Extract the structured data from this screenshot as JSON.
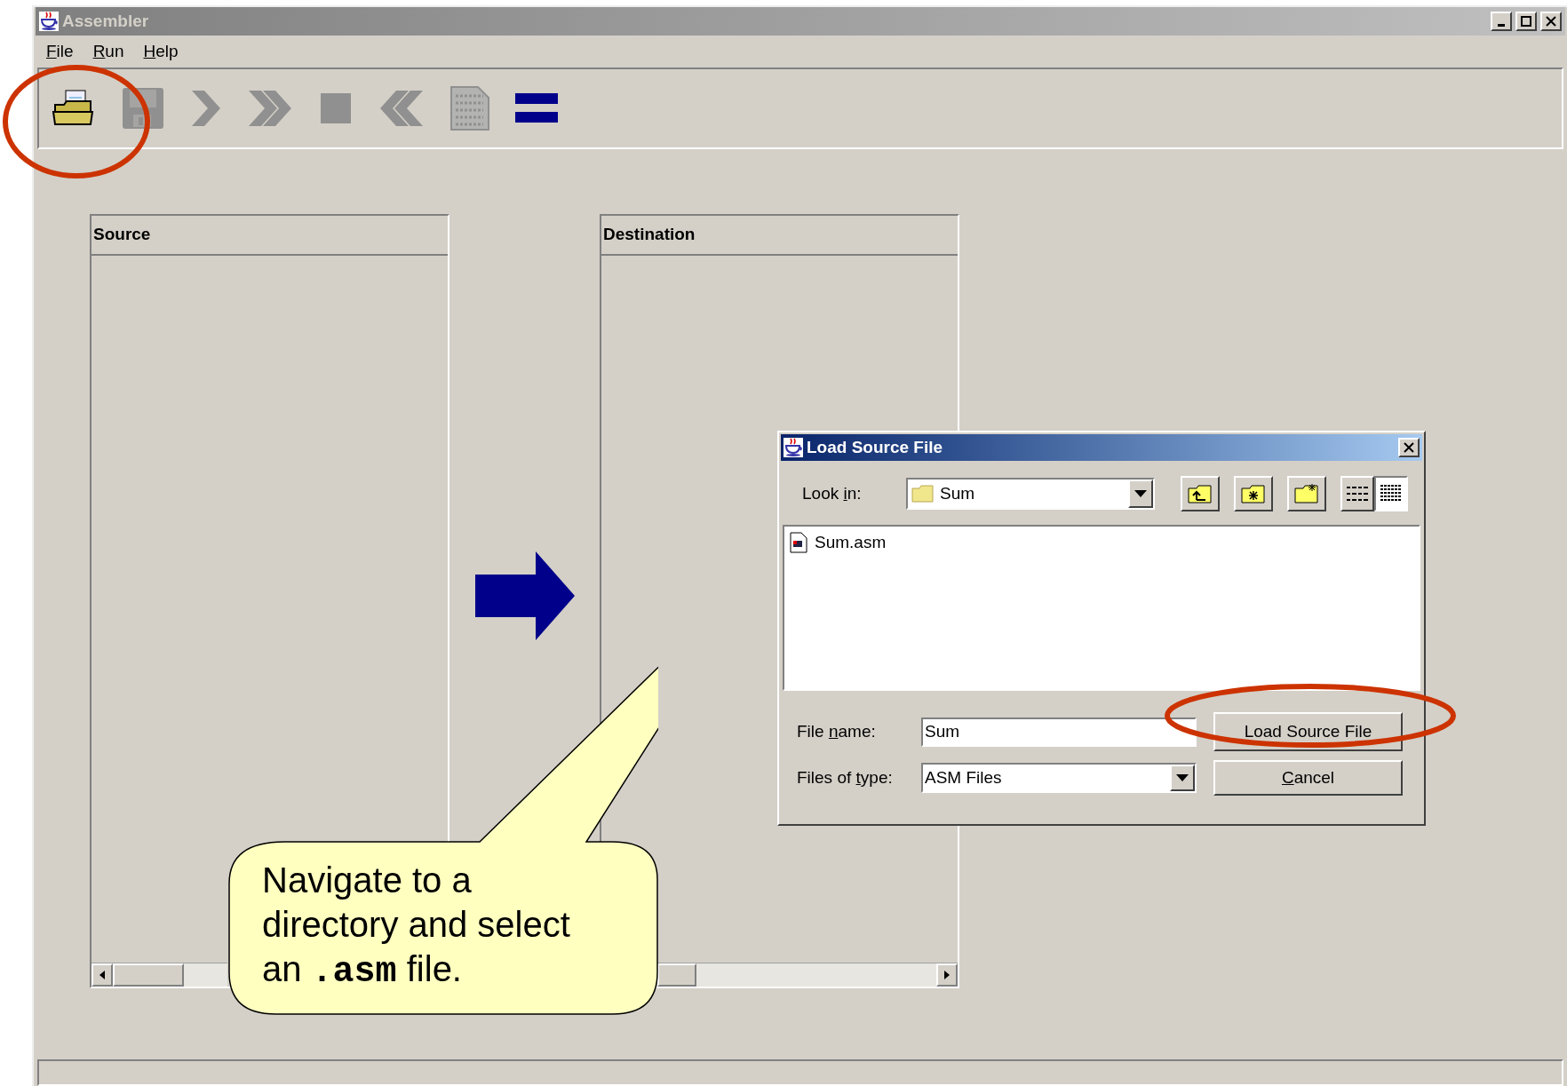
{
  "window": {
    "title": "Assembler"
  },
  "menu": [
    {
      "mnemonic": "F",
      "after": "ile"
    },
    {
      "mnemonic": "R",
      "after": "un"
    },
    {
      "mnemonic": "H",
      "after": "elp"
    }
  ],
  "toolbar": [
    {
      "kind": "open",
      "disabled": false
    },
    {
      "kind": "save",
      "disabled": true
    },
    {
      "kind": "step",
      "disabled": true
    },
    {
      "kind": "fast-forward",
      "disabled": true
    },
    {
      "kind": "stop",
      "disabled": true
    },
    {
      "kind": "rewind",
      "disabled": true
    },
    {
      "kind": "binary",
      "disabled": true
    },
    {
      "kind": "equals",
      "disabled": false
    }
  ],
  "panels": [
    {
      "title": "Source"
    },
    {
      "title": "Destination"
    }
  ],
  "dialog": {
    "title": "Load Source File",
    "look_in": {
      "label": {
        "before": "Look ",
        "mnemonic": "i",
        "after": "n:"
      },
      "value": "Sum"
    },
    "files": [
      {
        "name": "Sum.asm",
        "selected": false
      }
    ],
    "file_name": {
      "label": {
        "before": "File ",
        "mnemonic": "n",
        "after": "ame:"
      },
      "value": "Sum"
    },
    "file_type": {
      "label": {
        "before": "Files of ",
        "mnemonic": "t",
        "after": "ype:"
      },
      "value": "ASM Files"
    },
    "buttons": [
      {
        "after": "Load Source File"
      },
      {
        "mnemonic": "C",
        "after": "ancel"
      }
    ]
  },
  "callout": {
    "before": "Navigate to a directory and select an ",
    "code": ".asm",
    "after": " file."
  }
}
